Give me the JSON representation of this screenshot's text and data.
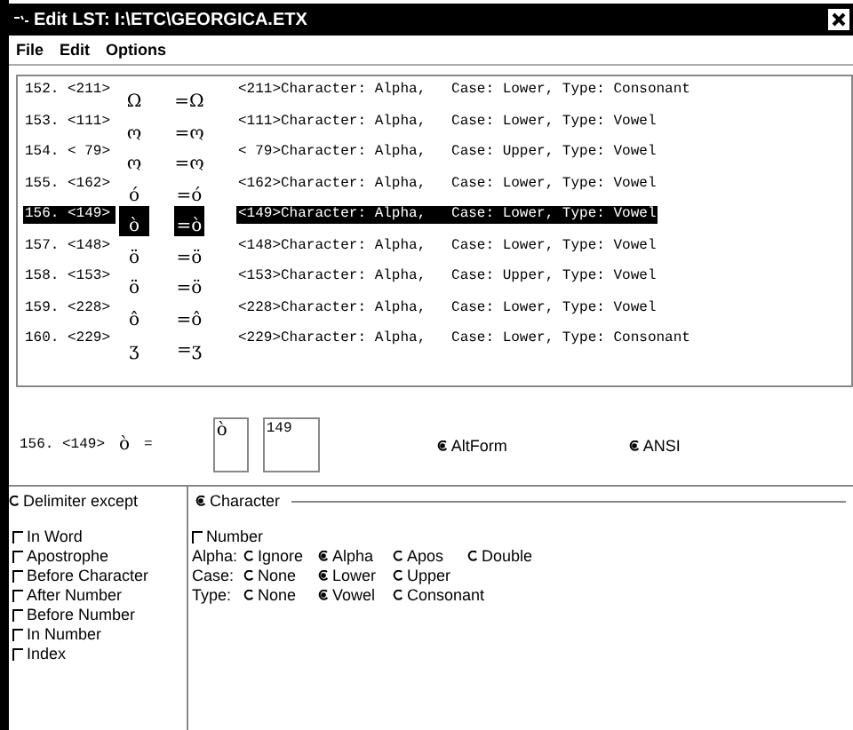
{
  "window": {
    "title": "Edit LST: I:\\ETC\\GEORGICA.ETX"
  },
  "menu": [
    "File",
    "Edit",
    "Options"
  ],
  "list": {
    "rows": [
      {
        "number": "152.",
        "code": "<211>",
        "glyph": "Ω",
        "glyph_alt": "=Ω",
        "description": "<211>Character: Alpha,   Case: Lower, Type: Consonant",
        "selected": false
      },
      {
        "number": "153.",
        "code": "<111>",
        "glyph": "ო",
        "glyph_alt": "=ო",
        "description": "<111>Character: Alpha,   Case: Lower, Type: Vowel",
        "selected": false
      },
      {
        "number": "154.",
        "code": "< 79>",
        "glyph": "ო",
        "glyph_alt": "=ო",
        "description": "< 79>Character: Alpha,   Case: Upper, Type: Vowel",
        "selected": false
      },
      {
        "number": "155.",
        "code": "<162>",
        "glyph": "ó",
        "glyph_alt": "=ó",
        "description": "<162>Character: Alpha,   Case: Lower, Type: Vowel",
        "selected": false
      },
      {
        "number": "156.",
        "code": "<149>",
        "glyph": "ò",
        "glyph_alt": "=ò",
        "description": "<149>Character: Alpha,   Case: Lower, Type: Vowel",
        "selected": true
      },
      {
        "number": "157.",
        "code": "<148>",
        "glyph": "ö",
        "glyph_alt": "=ö",
        "description": "<148>Character: Alpha,   Case: Lower, Type: Vowel",
        "selected": false
      },
      {
        "number": "158.",
        "code": "<153>",
        "glyph": "ö",
        "glyph_alt": "=ö",
        "description": "<153>Character: Alpha,   Case: Upper, Type: Vowel",
        "selected": false
      },
      {
        "number": "159.",
        "code": "<228>",
        "glyph": "ô",
        "glyph_alt": "=ô",
        "description": "<228>Character: Alpha,   Case: Lower, Type: Vowel",
        "selected": false
      },
      {
        "number": "160.",
        "code": "<229>",
        "glyph": "ʒ",
        "glyph_alt": "=ʒ",
        "description": "<229>Character: Alpha,   Case: Lower, Type: Consonant",
        "selected": false
      }
    ]
  },
  "detail": {
    "number": "156.",
    "code": "<149>",
    "glyph": "ò",
    "equals": "=",
    "preview_glyph": "ò",
    "code_value": "149",
    "options": [
      {
        "label": "AltForm",
        "checked": true
      },
      {
        "label": "ANSI",
        "checked": true
      }
    ]
  },
  "modes": [
    {
      "label": "Delimiter except",
      "selected": false
    },
    {
      "label": "Character",
      "selected": true
    }
  ],
  "delimiter_options": [
    {
      "label": "In Word",
      "checked": false
    },
    {
      "label": "Apostrophe",
      "checked": false
    },
    {
      "label": "Before Character",
      "checked": false
    },
    {
      "label": "After Number",
      "checked": false
    },
    {
      "label": "Before Number",
      "checked": false
    },
    {
      "label": "In Number",
      "checked": false
    },
    {
      "label": "Index",
      "checked": false
    }
  ],
  "character": {
    "number": {
      "label": "Number",
      "checked": false
    },
    "groups": [
      {
        "label": "Alpha:",
        "options": [
          {
            "label": "Ignore",
            "selected": false
          },
          {
            "label": "Alpha",
            "selected": true
          },
          {
            "label": "Apos",
            "selected": false
          },
          {
            "label": "Double",
            "selected": false
          }
        ]
      },
      {
        "label": "Case:",
        "options": [
          {
            "label": "None",
            "selected": false
          },
          {
            "label": "Lower",
            "selected": true
          },
          {
            "label": "Upper",
            "selected": false
          }
        ]
      },
      {
        "label": "Type:",
        "options": [
          {
            "label": "None",
            "selected": false
          },
          {
            "label": "Vowel",
            "selected": true
          },
          {
            "label": "Consonant",
            "selected": false
          }
        ]
      }
    ]
  }
}
